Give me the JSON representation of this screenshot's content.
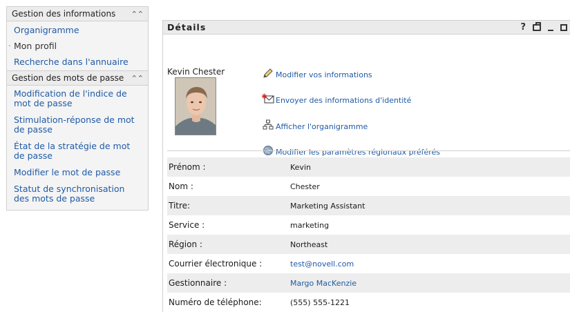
{
  "nav": {
    "group1": {
      "title": "Gestion des informations",
      "collapse_icon": "double-chevron-up-icon",
      "items": [
        "Organigramme",
        "Mon profil",
        "Recherche dans l'annuaire"
      ]
    },
    "group2": {
      "title": "Gestion des mots de passe",
      "collapse_icon": "double-chevron-up-icon",
      "items": [
        "Modification de l'indice de mot de passe",
        "Stimulation-réponse de mot de passe",
        "État de la stratégie de mot de passe",
        "Modifier le mot de passe",
        "Statut de synchronisation des mots de passe"
      ]
    }
  },
  "portlet": {
    "title": "Détails",
    "help": "?",
    "tool_icons": [
      "help-icon",
      "print-icon",
      "minimize-icon",
      "maximize-icon"
    ]
  },
  "profile": {
    "name": "Kevin Chester",
    "photo_icon": "user-photo"
  },
  "actions": [
    {
      "label": "Modifier vos informations",
      "icon": "pencil-icon"
    },
    {
      "label": "Envoyer des informations d'identité",
      "icon": "envelope-icon"
    },
    {
      "label": "Afficher l'organigramme",
      "icon": "org-chart-icon"
    },
    {
      "label": "Modifier les paramètres régionaux préférés",
      "icon": "globe-icon"
    }
  ],
  "fields": [
    {
      "label": "Prénom :",
      "value": "Kevin"
    },
    {
      "label": "Nom :",
      "value": "Chester"
    },
    {
      "label": "Titre:",
      "value": "Marketing Assistant"
    },
    {
      "label": "Service :",
      "value": "marketing"
    },
    {
      "label": "Région :",
      "value": "Northeast"
    },
    {
      "label": "Courrier électronique :",
      "value": "test@novell.com"
    },
    {
      "label": "Gestionnaire :",
      "value": "Margo MacKenzie"
    },
    {
      "label": "Numéro de téléphone:",
      "value": "(555) 555-1221"
    }
  ],
  "colors": {
    "link": "#1f5aa6",
    "header_bg": "#ececec",
    "nav_bg": "#f4f4f4",
    "row_alt": "#ededed"
  }
}
